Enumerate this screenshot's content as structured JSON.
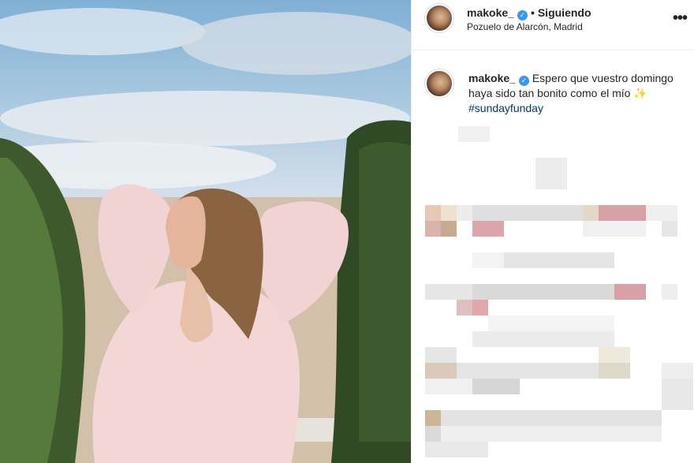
{
  "post": {
    "username": "makoke_",
    "verified_glyph": "✓",
    "separator": "•",
    "follow_state": "Siguiendo",
    "location": "Pozuelo de Alarcón, Madrid",
    "more_glyph": "•••"
  },
  "caption": {
    "username": "makoke_",
    "text": "Espero que vuestro domingo haya sido tan bonito como el mío",
    "emoji": "✨",
    "hashtag": "#sundayfunday"
  },
  "icons": {
    "verified": "verified-badge-icon",
    "more": "more-options-icon"
  },
  "colors": {
    "verified_blue": "#3897f0",
    "hashtag": "#00376b",
    "text": "#262626",
    "divider": "#efefef"
  },
  "comments_area": "pixelated"
}
